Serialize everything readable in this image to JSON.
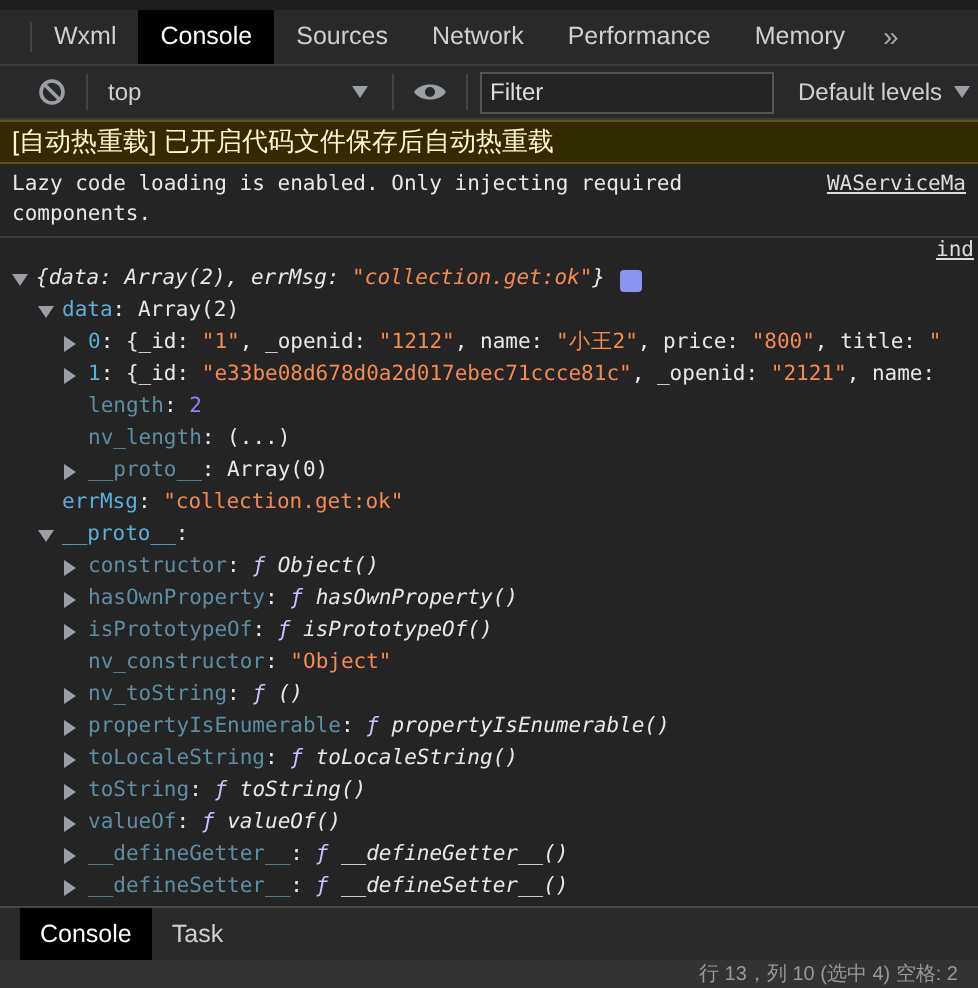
{
  "tabs": [
    {
      "label": "Wxml",
      "selected": false
    },
    {
      "label": "Console",
      "selected": true
    },
    {
      "label": "Sources",
      "selected": false
    },
    {
      "label": "Network",
      "selected": false
    },
    {
      "label": "Performance",
      "selected": false
    },
    {
      "label": "Memory",
      "selected": false
    }
  ],
  "more_tabs": "»",
  "toolbar": {
    "context": "top",
    "filter": {
      "placeholder": "Filter"
    },
    "levels": "Default levels"
  },
  "messages": [
    {
      "kind": "warning",
      "text": "[自动热重载] 已开启代码文件保存后自动热重载"
    },
    {
      "kind": "info",
      "text": "Lazy code loading is enabled. Only injecting required components.",
      "source": "WAServiceMa"
    }
  ],
  "log_source": "ind",
  "tree": [
    {
      "kind": "branch",
      "expanded": true,
      "parts": [
        {
          "text": "{data: Array(2), errMsg: ",
          "kind": "italic"
        },
        {
          "text": "\"collection.get:ok\"",
          "kind": "istring"
        },
        {
          "text": "}",
          "kind": "italic"
        }
      ],
      "info_badge": true,
      "children": [
        {
          "kind": "branch",
          "expanded": true,
          "parts": [
            {
              "text": "data",
              "kind": "key"
            },
            {
              "text": ": Array(2)",
              "kind": "plain"
            }
          ],
          "children": [
            {
              "kind": "branch",
              "expanded": false,
              "parts": [
                {
                  "text": "0",
                  "kind": "key"
                },
                {
                  "text": ": {_id: ",
                  "kind": "plain"
                },
                {
                  "text": "\"1\"",
                  "kind": "string"
                },
                {
                  "text": ", _openid: ",
                  "kind": "plain"
                },
                {
                  "text": "\"1212\"",
                  "kind": "string"
                },
                {
                  "text": ", name: ",
                  "kind": "plain"
                },
                {
                  "text": "\"小王2\"",
                  "kind": "string"
                },
                {
                  "text": ", price: ",
                  "kind": "plain"
                },
                {
                  "text": "\"800\"",
                  "kind": "string"
                },
                {
                  "text": ", title: ",
                  "kind": "plain"
                },
                {
                  "text": "\"",
                  "kind": "string"
                }
              ]
            },
            {
              "kind": "branch",
              "expanded": false,
              "parts": [
                {
                  "text": "1",
                  "kind": "key"
                },
                {
                  "text": ": {_id: ",
                  "kind": "plain"
                },
                {
                  "text": "\"e33be08d678d0a2d017ebec71ccce81c\"",
                  "kind": "string"
                },
                {
                  "text": ", _openid: ",
                  "kind": "plain"
                },
                {
                  "text": "\"2121\"",
                  "kind": "string"
                },
                {
                  "text": ", name:",
                  "kind": "plain"
                }
              ]
            },
            {
              "kind": "leaf",
              "parts": [
                {
                  "text": "length",
                  "kind": "dimkey"
                },
                {
                  "text": ": ",
                  "kind": "plain"
                },
                {
                  "text": "2",
                  "kind": "number"
                }
              ]
            },
            {
              "kind": "leaf",
              "parts": [
                {
                  "text": "nv_length",
                  "kind": "dimkey"
                },
                {
                  "text": ": (...)",
                  "kind": "plain"
                }
              ]
            },
            {
              "kind": "branch",
              "expanded": false,
              "parts": [
                {
                  "text": "__proto__",
                  "kind": "dimkey"
                },
                {
                  "text": ": Array(0)",
                  "kind": "plain"
                }
              ]
            }
          ]
        },
        {
          "kind": "leaf",
          "parts": [
            {
              "text": "errMsg",
              "kind": "key"
            },
            {
              "text": ": ",
              "kind": "plain"
            },
            {
              "text": "\"collection.get:ok\"",
              "kind": "string"
            }
          ]
        },
        {
          "kind": "branch",
          "expanded": true,
          "parts": [
            {
              "text": "__proto__",
              "kind": "key"
            },
            {
              "text": ":",
              "kind": "plain"
            }
          ],
          "children": [
            {
              "kind": "branch",
              "expanded": false,
              "parts": [
                {
                  "text": "constructor",
                  "kind": "dimkey"
                },
                {
                  "text": ": ",
                  "kind": "plain"
                },
                {
                  "text": "ƒ",
                  "kind": "func"
                },
                {
                  "text": " Object()",
                  "kind": "italic"
                }
              ]
            },
            {
              "kind": "branch",
              "expanded": false,
              "parts": [
                {
                  "text": "hasOwnProperty",
                  "kind": "dimkey"
                },
                {
                  "text": ": ",
                  "kind": "plain"
                },
                {
                  "text": "ƒ",
                  "kind": "func"
                },
                {
                  "text": " hasOwnProperty()",
                  "kind": "italic"
                }
              ]
            },
            {
              "kind": "branch",
              "expanded": false,
              "parts": [
                {
                  "text": "isPrototypeOf",
                  "kind": "dimkey"
                },
                {
                  "text": ": ",
                  "kind": "plain"
                },
                {
                  "text": "ƒ",
                  "kind": "func"
                },
                {
                  "text": " isPrototypeOf()",
                  "kind": "italic"
                }
              ]
            },
            {
              "kind": "leaf",
              "parts": [
                {
                  "text": "nv_constructor",
                  "kind": "dimkey"
                },
                {
                  "text": ": ",
                  "kind": "plain"
                },
                {
                  "text": "\"Object\"",
                  "kind": "string"
                }
              ]
            },
            {
              "kind": "branch",
              "expanded": false,
              "parts": [
                {
                  "text": "nv_toString",
                  "kind": "dimkey"
                },
                {
                  "text": ": ",
                  "kind": "plain"
                },
                {
                  "text": "ƒ",
                  "kind": "func"
                },
                {
                  "text": " ()",
                  "kind": "italic"
                }
              ]
            },
            {
              "kind": "branch",
              "expanded": false,
              "parts": [
                {
                  "text": "propertyIsEnumerable",
                  "kind": "dimkey"
                },
                {
                  "text": ": ",
                  "kind": "plain"
                },
                {
                  "text": "ƒ",
                  "kind": "func"
                },
                {
                  "text": " propertyIsEnumerable()",
                  "kind": "italic"
                }
              ]
            },
            {
              "kind": "branch",
              "expanded": false,
              "parts": [
                {
                  "text": "toLocaleString",
                  "kind": "dimkey"
                },
                {
                  "text": ": ",
                  "kind": "plain"
                },
                {
                  "text": "ƒ",
                  "kind": "func"
                },
                {
                  "text": " toLocaleString()",
                  "kind": "italic"
                }
              ]
            },
            {
              "kind": "branch",
              "expanded": false,
              "parts": [
                {
                  "text": "toString",
                  "kind": "dimkey"
                },
                {
                  "text": ": ",
                  "kind": "plain"
                },
                {
                  "text": "ƒ",
                  "kind": "func"
                },
                {
                  "text": " toString()",
                  "kind": "italic"
                }
              ]
            },
            {
              "kind": "branch",
              "expanded": false,
              "parts": [
                {
                  "text": "valueOf",
                  "kind": "dimkey"
                },
                {
                  "text": ": ",
                  "kind": "plain"
                },
                {
                  "text": "ƒ",
                  "kind": "func"
                },
                {
                  "text": " valueOf()",
                  "kind": "italic"
                }
              ]
            },
            {
              "kind": "branch",
              "expanded": false,
              "parts": [
                {
                  "text": "__defineGetter__",
                  "kind": "dimkey"
                },
                {
                  "text": ": ",
                  "kind": "plain"
                },
                {
                  "text": "ƒ",
                  "kind": "func"
                },
                {
                  "text": " __defineGetter__()",
                  "kind": "italic"
                }
              ]
            },
            {
              "kind": "branch",
              "expanded": false,
              "parts": [
                {
                  "text": "__defineSetter__",
                  "kind": "dimkey"
                },
                {
                  "text": ": ",
                  "kind": "plain"
                },
                {
                  "text": "ƒ",
                  "kind": "func"
                },
                {
                  "text": " __defineSetter__()",
                  "kind": "italic"
                }
              ]
            }
          ]
        }
      ]
    }
  ],
  "drawer_tabs": [
    {
      "label": "Console",
      "selected": true
    },
    {
      "label": "Task",
      "selected": false
    }
  ],
  "status_bar": "行 13，列 10 (选中 4)   空格: 2"
}
